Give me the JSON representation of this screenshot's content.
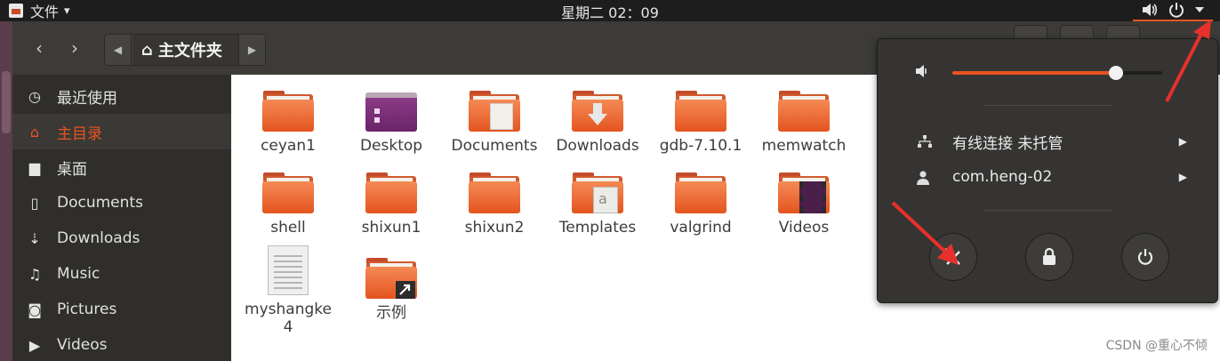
{
  "topbar": {
    "app_name": "文件",
    "app_menu_arrow": "▾",
    "clock": "星期二 02：09",
    "tray_icons": [
      "volume-icon",
      "power-icon",
      "dropdown-arrow-icon"
    ]
  },
  "toolbar": {
    "back": "‹",
    "forward": "›",
    "path_left": "◀",
    "path_home_icon": "⌂",
    "path_current": "主文件夹",
    "path_right": "▶"
  },
  "sidebar": {
    "items": [
      {
        "label": "最近使用",
        "icon": "◷"
      },
      {
        "label": "主目录",
        "icon": "⌂"
      },
      {
        "label": "桌面",
        "icon": "▆"
      },
      {
        "label": "Documents",
        "icon": "▯"
      },
      {
        "label": "Downloads",
        "icon": "⇣"
      },
      {
        "label": "Music",
        "icon": "♫"
      },
      {
        "label": "Pictures",
        "icon": "◙"
      },
      {
        "label": "Videos",
        "icon": "▶"
      }
    ],
    "active_index": 1
  },
  "files": {
    "row1": [
      "ceyan1",
      "Desktop",
      "Documents",
      "Downloads",
      "gdb-7.10.1",
      "memwatch"
    ],
    "row2": [
      "shell",
      "shixun1",
      "shixun2",
      "Templates",
      "valgrind",
      "Videos"
    ],
    "row3_item0_line1": "myshangke",
    "row3_item0_line2": "4",
    "row3_item1": "示例"
  },
  "system_menu": {
    "volume_level_percent": 78,
    "network_label": "有线连接 未托管",
    "user_label": "com.heng-02",
    "submenu_arrow": "▶",
    "settings_glyph": "✂",
    "lock_glyph": "🔒",
    "power_glyph": "⏻"
  },
  "colors": {
    "accent": "#e95420",
    "annotation": "#e8302c"
  },
  "watermark": "CSDN @重心不倾"
}
